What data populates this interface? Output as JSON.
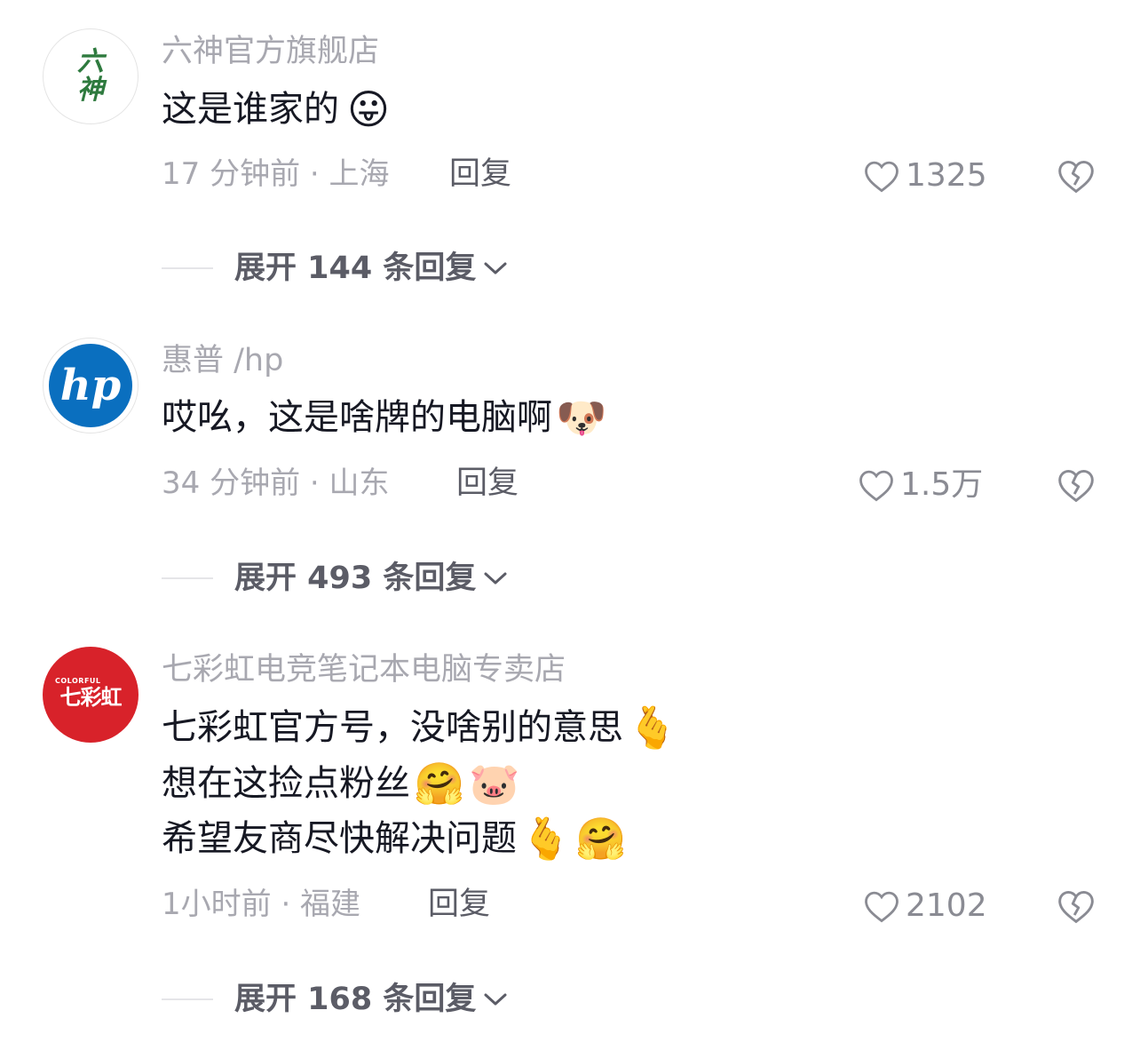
{
  "comments": [
    {
      "author": "六神官方旗舰店",
      "avatar_text": "六神",
      "lines": [
        {
          "text": "这是谁家的",
          "emojis": [
            "😛"
          ]
        }
      ],
      "time_location": "17 分钟前 · 上海",
      "reply_label": "回复",
      "likes": "1325",
      "expand_label": "展开 144 条回复"
    },
    {
      "author": "惠普 /hp",
      "avatar_text": "hp",
      "lines": [
        {
          "text": "哎吆，这是啥牌的电脑啊",
          "emojis": [
            "🐶"
          ]
        }
      ],
      "time_location": "34 分钟前 · 山东",
      "reply_label": "回复",
      "likes": "1.5万",
      "expand_label": "展开 493 条回复"
    },
    {
      "author": "七彩虹电竞笔记本电脑专卖店",
      "avatar_text": "七彩虹",
      "avatar_small": "COLORFUL",
      "lines": [
        {
          "text": "七彩虹官方号，没啥别的意思",
          "emojis": [
            "🫰"
          ]
        },
        {
          "text": "想在这捡点粉丝",
          "emojis": [
            "🤗",
            "🐷"
          ]
        },
        {
          "text": "希望友商尽快解决问题",
          "emojis": [
            "🫰",
            "🤗"
          ]
        }
      ],
      "time_location": "1小时前 · 福建",
      "reply_label": "回复",
      "likes": "2102",
      "expand_label": "展开 168 条回复"
    }
  ],
  "icons": {
    "like": "heart-outline-icon",
    "dislike": "broken-heart-icon",
    "expand": "chevron-down-icon"
  },
  "colors": {
    "text_primary": "#161823",
    "text_secondary": "#a8a8b0",
    "reply": "#5b5c66",
    "colorful_brand": "#d8222a",
    "hp_brand": "#0a6fbf",
    "liushen_brand": "#2e7a3e"
  }
}
